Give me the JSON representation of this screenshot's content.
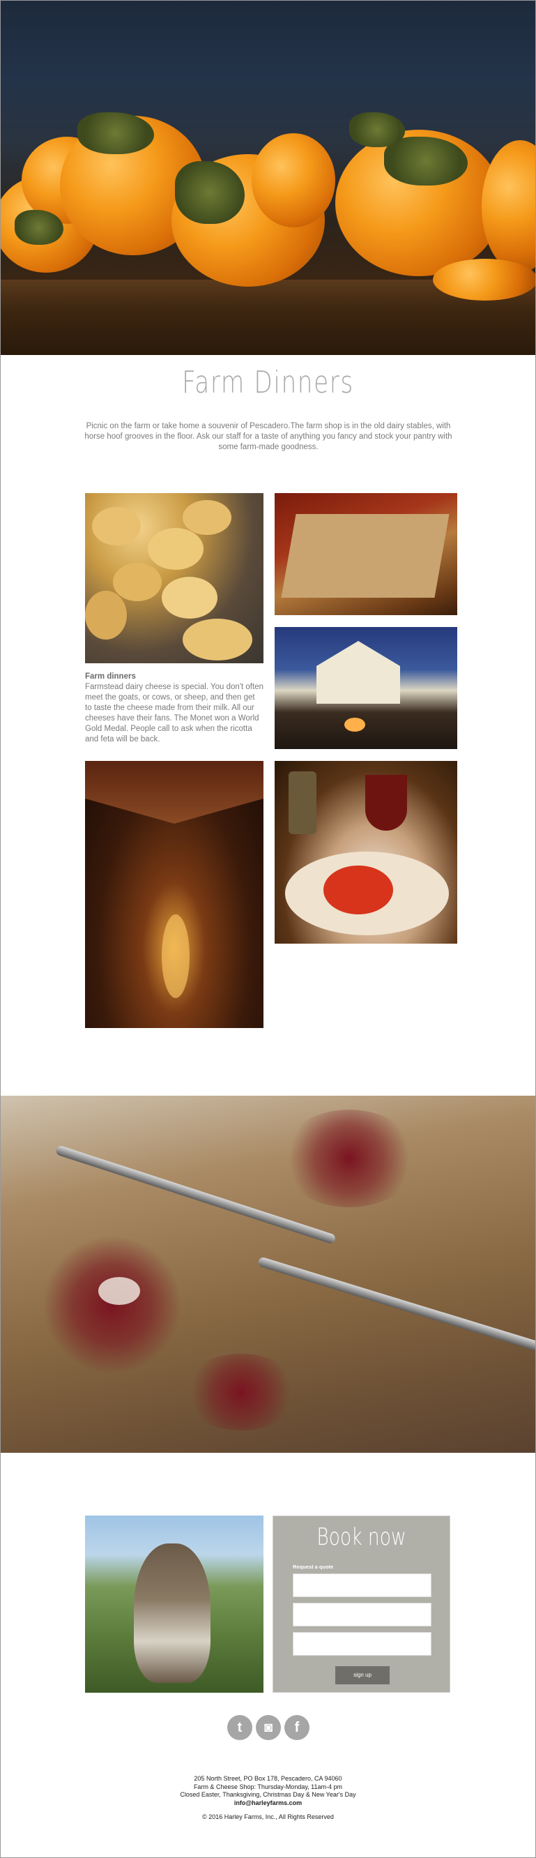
{
  "page": {
    "title": "Farm Dinners",
    "intro": "Picnic on the farm or take home a souvenir of Pescadero.The farm shop is in the old dairy stables, with horse hoof grooves in the floor. Ask our staff for a taste of anything you fancy and stock your pantry with some farm-made goodness."
  },
  "caption": {
    "title": "Farm dinners",
    "body": "Farmstead dairy cheese is special. You don't often meet the goats, or cows, or sheep, and then get to taste the cheese made from their milk. All our cheeses have their fans. The Monet won a World Gold Medal. People call to ask when the ricotta and feta will be back."
  },
  "booking": {
    "title": "Book now",
    "subtitle": "Request a quote",
    "button": "sign up"
  },
  "social": {
    "twitter": "t",
    "instagram": "◙",
    "facebook": "f"
  },
  "footer": {
    "address": "205 North Street, PO Box 178, Pescadero, CA 94060",
    "hours": "Farm & Cheese Shop: Thursday-Monday, 11am-4 pm",
    "closed": "Closed Easter, Thanksgiving, Christmas Day & New Year's Day",
    "email": "info@harleyfarms.com",
    "copyright": "© 2016 Harley Farms, Inc., All Rights Reserved"
  },
  "colors": {
    "book_bg": "#b0afa8",
    "button_bg": "#6f6e69",
    "title_gray": "#a9a9a9"
  }
}
